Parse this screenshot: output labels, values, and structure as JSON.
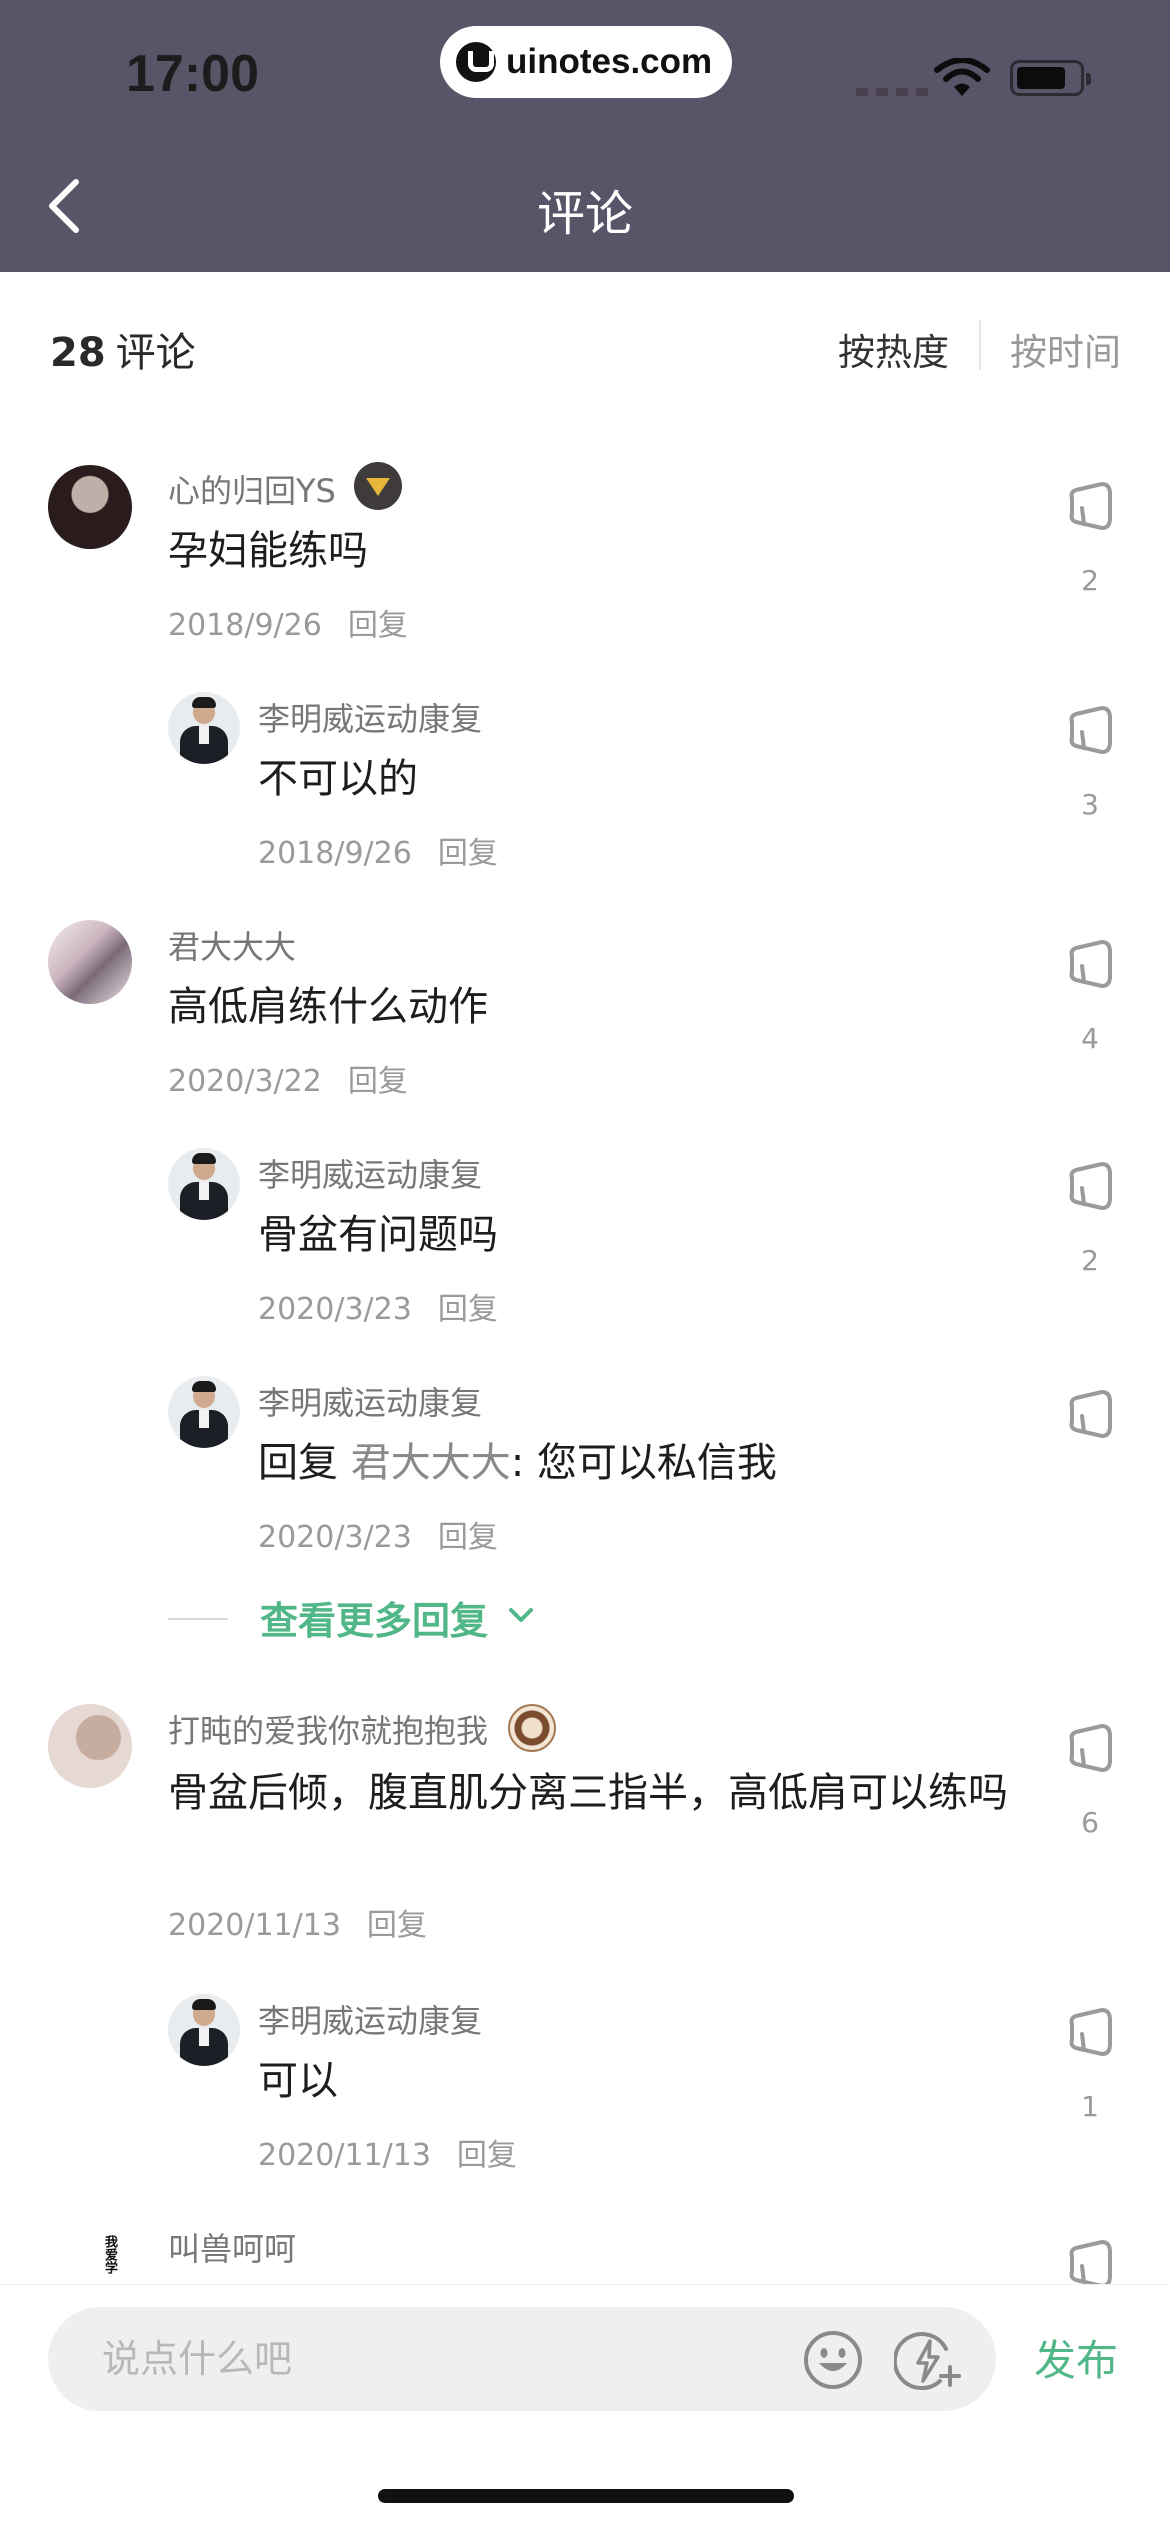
{
  "status_bar": {
    "time": "17:00",
    "url": "uinotes.com"
  },
  "nav": {
    "title": "评论"
  },
  "summary": {
    "count": "28",
    "count_label": "评论",
    "sort_hot": "按热度",
    "sort_time": "按时间"
  },
  "comments": [
    {
      "user": "心的归回YS",
      "text": "孕妇能练吗",
      "date": "2018/9/26",
      "reply": "回复",
      "likes": "2"
    },
    {
      "user": "李明威运动康复",
      "text": "不可以的",
      "date": "2018/9/26",
      "reply": "回复",
      "likes": "3"
    },
    {
      "user": "君大大大",
      "text": "高低肩练什么动作",
      "date": "2020/3/22",
      "reply": "回复",
      "likes": "4"
    },
    {
      "user": "李明威运动康复",
      "text": "骨盆有问题吗",
      "date": "2020/3/23",
      "reply": "回复",
      "likes": "2"
    },
    {
      "user": "李明威运动康复",
      "text_prefix": "回复 ",
      "mention": "君大大大",
      "text_suffix": ": 您可以私信我",
      "date": "2020/3/23",
      "reply": "回复",
      "likes": ""
    },
    {
      "user": "打盹的爱我你就抱抱我",
      "text": "骨盆后倾，腹直肌分离三指半，高低肩可以练吗",
      "date": "2020/11/13",
      "reply": "回复",
      "likes": "6"
    },
    {
      "user": "李明威运动康复",
      "text": "可以",
      "date": "2020/11/13",
      "reply": "回复",
      "likes": "1"
    },
    {
      "user": "叫兽呵呵",
      "avatar_text": "我爱学"
    }
  ],
  "more_replies": "查看更多回复",
  "input": {
    "placeholder": "说点什么吧",
    "publish": "发布"
  },
  "colors": {
    "header_bg": "#5a5468",
    "accent_green": "#52b788"
  }
}
